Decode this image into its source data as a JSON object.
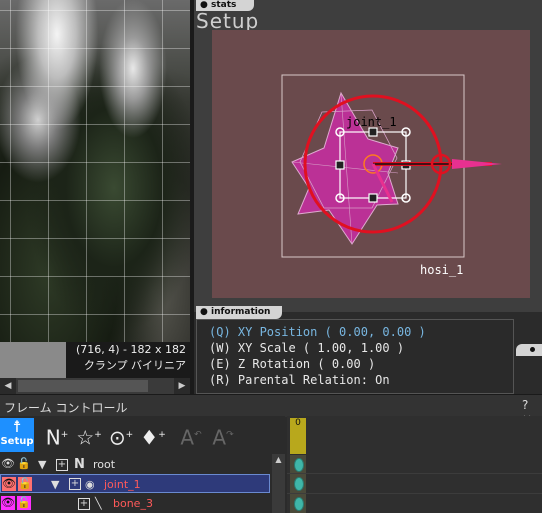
{
  "viewer": {
    "coord_line": "(716, 4) - 182 x 182",
    "mode_line": "クランプ バイリニア"
  },
  "stats_panel": {
    "tab_label": "stats",
    "title": "Setup",
    "joint_label": "joint_1",
    "sprite_label": "hosi_1"
  },
  "information": {
    "tab_label": "information",
    "lines": [
      "(Q) XY Position ( 0.00, 0.00 )",
      "(W) XY Scale ( 1.00, 1.00 )",
      "(E) Z Rotation ( 0.00 )",
      "(R) Parental Relation: On"
    ]
  },
  "frame_control": {
    "title": "フレーム コントロール",
    "help": "?",
    "close": "×",
    "setup_button": "Setup",
    "frame_number": "0"
  },
  "tree": [
    {
      "label": "root",
      "type": "null",
      "color": "#e0e0e0",
      "selected": false
    },
    {
      "label": "joint_1",
      "type": "joint",
      "color": "#ff5a5a",
      "selected": true
    },
    {
      "label": "bone_3",
      "type": "bone",
      "color": "#ff5a5a",
      "selected": false
    }
  ],
  "colors": {
    "accent": "#1e90ff",
    "selection": "#2e3a7a",
    "active_info": "#78b6e0",
    "star": "#c0309a",
    "circle": "#e01020",
    "canvas_bg": "#6a4a4c"
  }
}
